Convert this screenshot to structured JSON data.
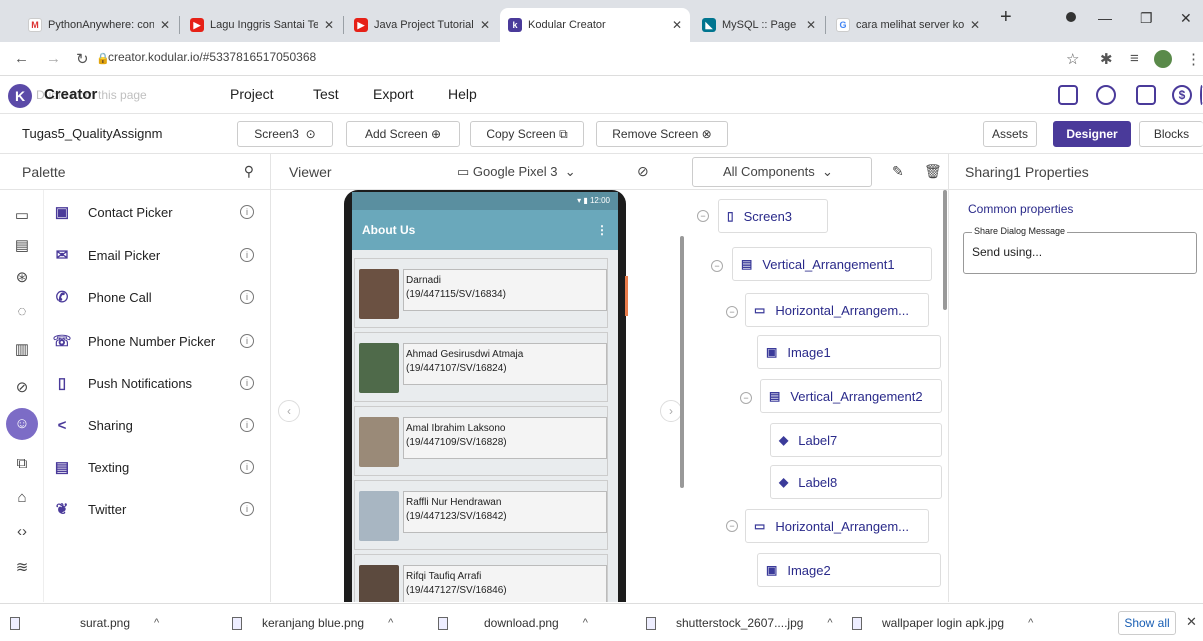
{
  "browser": {
    "tabs": [
      {
        "title": "PythonAnywhere: conf",
        "icon": "gmail-icon"
      },
      {
        "title": "Lagu Inggris Santai Te",
        "icon": "youtube-icon"
      },
      {
        "title": "Java Project Tutorial -",
        "icon": "youtube-icon"
      },
      {
        "title": "Kodular Creator",
        "icon": "kodular-icon"
      },
      {
        "title": "MySQL :: Page Not Fo",
        "icon": "mysql-icon"
      },
      {
        "title": "cara melihat server ko",
        "icon": "google-icon"
      }
    ],
    "url": "creator.kodular.io/#5337816517050368"
  },
  "menu": {
    "brand": "Creator",
    "overlay_text": "Dudio from this page",
    "items": [
      "Project",
      "Test",
      "Export",
      "Help"
    ]
  },
  "project": {
    "name": "Tugas5_QualityAssignm",
    "screen": "Screen3",
    "add_screen": "Add Screen",
    "copy_screen": "Copy Screen",
    "remove_screen": "Remove Screen",
    "assets": "Assets",
    "designer": "Designer",
    "blocks": "Blocks"
  },
  "palette": {
    "title": "Palette",
    "items": [
      {
        "label": "Contact Picker",
        "icon": "contact-picker-icon"
      },
      {
        "label": "Email Picker",
        "icon": "email-icon"
      },
      {
        "label": "Phone Call",
        "icon": "phone-icon"
      },
      {
        "label": "Phone Number Picker",
        "icon": "phone-list-icon"
      },
      {
        "label": "Push Notifications",
        "icon": "notification-icon"
      },
      {
        "label": "Sharing",
        "icon": "share-icon"
      },
      {
        "label": "Texting",
        "icon": "message-icon"
      },
      {
        "label": "Twitter",
        "icon": "twitter-icon"
      }
    ]
  },
  "viewer": {
    "title": "Viewer",
    "device": "Google Pixel 3",
    "status_time": "12:00",
    "app_title": "About Us",
    "students": [
      {
        "name": "Darnadi",
        "nim": "(19/447115/SV/16834)"
      },
      {
        "name": "Ahmad Gesirusdwi Atmaja",
        "nim": "(19/447107/SV/16824)"
      },
      {
        "name": "Amal Ibrahim Laksono",
        "nim": "(19/447109/SV/16828)"
      },
      {
        "name": "Raffli Nur Hendrawan",
        "nim": "(19/447123/SV/16842)"
      },
      {
        "name": "Rifqi Taufiq Arrafi",
        "nim": "(19/447127/SV/16846)"
      }
    ]
  },
  "components": {
    "title": "All Components",
    "tree": [
      "Screen3",
      "Vertical_Arrangement1",
      "Horizontal_Arrangem...",
      "Image1",
      "Vertical_Arrangement2",
      "Label7",
      "Label8",
      "Horizontal_Arrangem...",
      "Image2"
    ]
  },
  "properties": {
    "title": "Sharing1 Properties",
    "section": "Common properties",
    "field_label": "Share Dialog Message",
    "field_value": "Send using..."
  },
  "downloads": {
    "items": [
      "surat.png",
      "keranjang blue.png",
      "download.png",
      "shutterstock_2607....jpg",
      "wallpaper login apk.jpg"
    ],
    "show_all": "Show all"
  }
}
